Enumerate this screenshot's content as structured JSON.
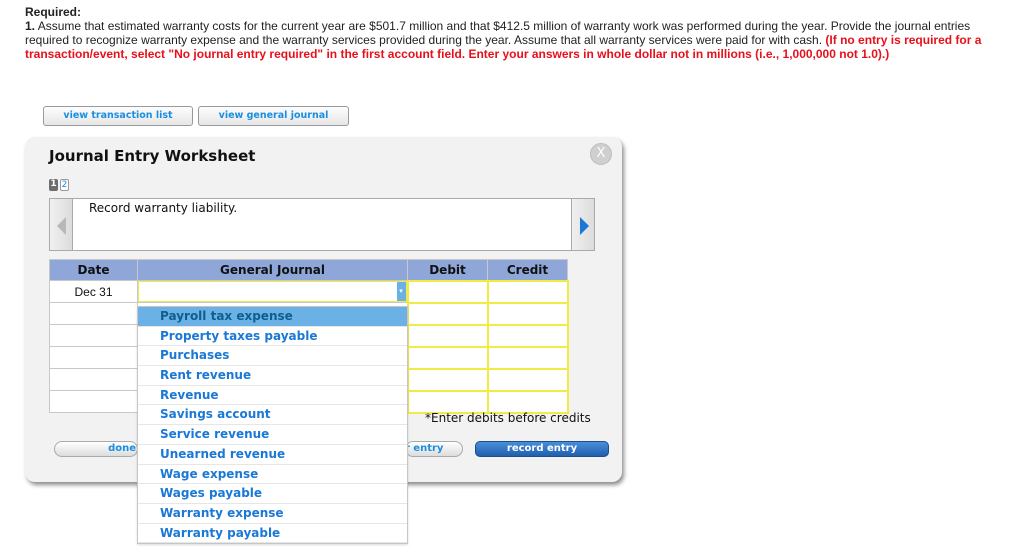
{
  "required": {
    "title": "Required:",
    "number": "1.",
    "text": " Assume that estimated warranty costs for the current year are $501.7 million and that $412.5 million of warranty work was performed during the year. Provide the journal entries required to recognize warranty expense and the warranty services provided during the year. Assume that all warranty services were paid for with cash. ",
    "instruction": "(If no entry is required for a transaction/event, select \"No journal entry required\" in the first account field. Enter your answers in whole dollar not in millions (i.e., 1,000,000 not 1.0).)"
  },
  "top_buttons": {
    "view_transaction_list": "view transaction list",
    "view_general_journal": "view general journal"
  },
  "worksheet": {
    "title": "Journal Entry Worksheet",
    "close_label": "X",
    "pages": [
      "1",
      "2"
    ],
    "current_page": "1",
    "description": "Record warranty liability.",
    "columns": {
      "date": "Date",
      "general_journal": "General Journal",
      "debit": "Debit",
      "credit": "Credit"
    },
    "rows": [
      {
        "date": "Dec 31",
        "account": "",
        "debit": "",
        "credit": ""
      },
      {
        "date": "",
        "account": "",
        "debit": "",
        "credit": ""
      },
      {
        "date": "",
        "account": "",
        "debit": "",
        "credit": ""
      },
      {
        "date": "",
        "account": "",
        "debit": "",
        "credit": ""
      },
      {
        "date": "",
        "account": "",
        "debit": "",
        "credit": ""
      },
      {
        "date": "",
        "account": "",
        "debit": "",
        "credit": ""
      }
    ],
    "hint": "*Enter debits before credits",
    "buttons": {
      "done": "done",
      "clear_entry": "clear entry",
      "record_entry": "record entry"
    }
  },
  "dropdown": {
    "highlighted": "Payroll tax expense",
    "options": [
      "Payroll tax expense",
      "Property taxes payable",
      "Purchases",
      "Rent revenue",
      "Revenue",
      "Savings account",
      "Service revenue",
      "Unearned revenue",
      "Wage expense",
      "Wages payable",
      "Warranty expense",
      "Warranty payable"
    ]
  }
}
